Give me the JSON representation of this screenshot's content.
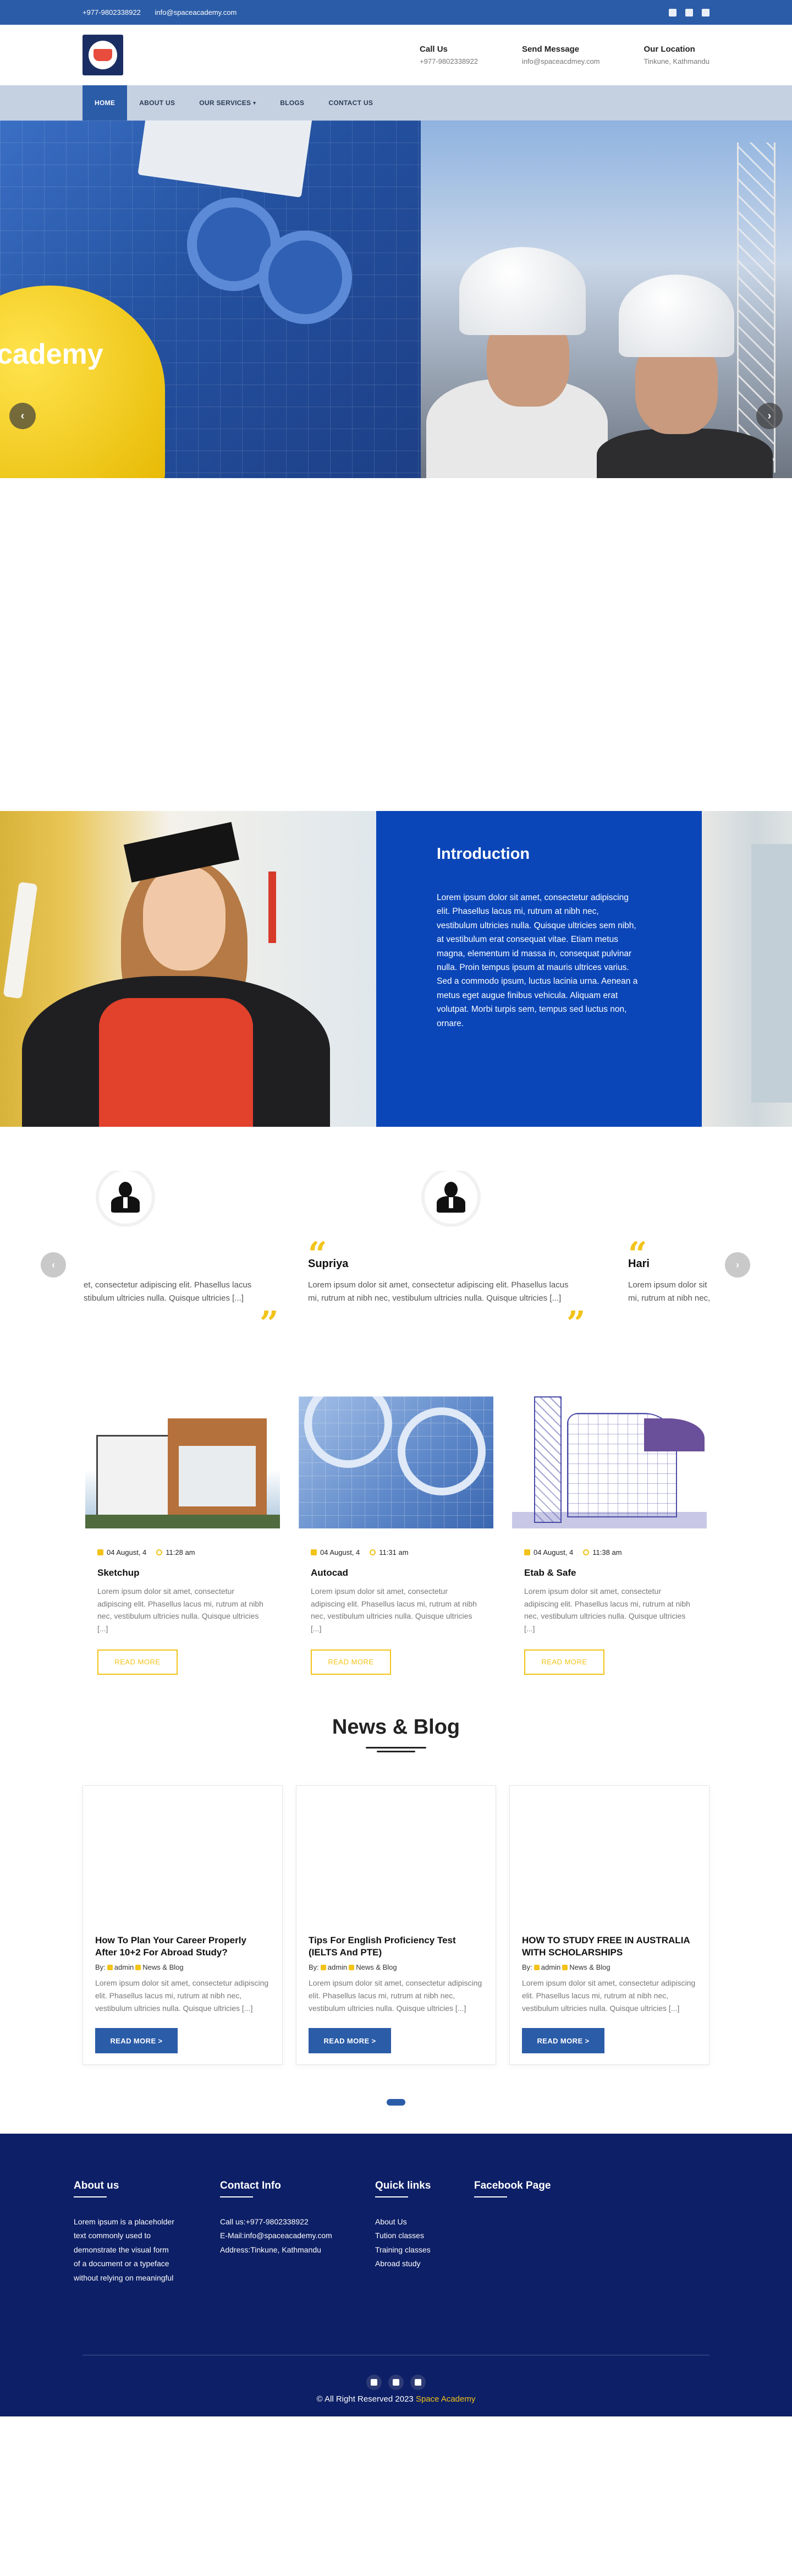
{
  "topbar": {
    "phone": "+977-9802338922",
    "email": "info@spaceacademy.com",
    "socials": [
      "facebook-icon",
      "youtube-icon",
      "instagram-icon"
    ]
  },
  "header": {
    "call": {
      "title": "Call Us",
      "value": "+977-9802338922"
    },
    "message": {
      "title": "Send Message",
      "value": "info@spaceacdmey.com"
    },
    "location": {
      "title": "Our Location",
      "value": "Tinkune, Kathmandu"
    }
  },
  "nav": {
    "items": [
      "HOME",
      "ABOUT US",
      "OUR SERVICES",
      "BLOGS",
      "CONTACT US"
    ],
    "active": "HOME"
  },
  "hero": {
    "title": "cademy",
    "prev": "‹",
    "next": "›"
  },
  "intro": {
    "title": "Introduction",
    "text": "Lorem ipsum dolor sit amet, consectetur adipiscing elit. Phasellus lacus mi, rutrum at nibh nec, vestibulum ultricies nulla. Quisque ultricies sem nibh, at vestibulum erat consequat vitae. Etiam metus magna, elementum id massa in, consequat pulvinar nulla. Proin tempus ipsum at mauris ultrices varius. Sed a commodo ipsum, luctus lacinia urna. Aenean a metus eget augue finibus vehicula. Aliquam erat volutpat. Morbi turpis sem, tempus sed luctus non, ornare."
  },
  "testimonials": {
    "prev": "‹",
    "next": "›",
    "items": [
      {
        "name": "",
        "line1": "et, consectetur adipiscing elit. Phasellus lacus",
        "line2": "stibulum ultricies nulla. Quisque ultricies [...]"
      },
      {
        "name": "Supriya",
        "line1": "Lorem ipsum dolor sit amet, consectetur adipiscing elit. Phasellus lacus",
        "line2": "mi, rutrum at nibh nec, vestibulum ultricies nulla. Quisque ultricies [...]"
      },
      {
        "name": "Hari",
        "line1": "Lorem ipsum dolor sit amet, c",
        "line2": "mi, rutrum at nibh nec, vestib"
      }
    ]
  },
  "courses": [
    {
      "date": "04 August, 4",
      "time": "11:28 am",
      "title": "Sketchup",
      "text": "Lorem ipsum dolor sit amet, consectetur adipiscing elit. Phasellus lacus mi, rutrum at nibh nec, vestibulum ultricies nulla. Quisque ultricies [...]",
      "button": "READ MORE"
    },
    {
      "date": "04 August, 4",
      "time": "11:31 am",
      "title": "Autocad",
      "text": "Lorem ipsum dolor sit amet, consectetur adipiscing elit. Phasellus lacus mi, rutrum at nibh nec, vestibulum ultricies nulla. Quisque ultricies [...]",
      "button": "READ MORE"
    },
    {
      "date": "04 August, 4",
      "time": "11:38 am",
      "title": "Etab & Safe",
      "text": "Lorem ipsum dolor sit amet, consectetur adipiscing elit. Phasellus lacus mi, rutrum at nibh nec, vestibulum ultricies nulla. Quisque ultricies [...]",
      "button": "READ MORE"
    }
  ],
  "news": {
    "title": "News & Blog",
    "posts": [
      {
        "title": "How To Plan Your Career Properly After 10+2 For Abroad Study?",
        "by": "By:",
        "author": "admin",
        "category": "News & Blog",
        "text": "Lorem ipsum dolor sit amet, consectetur adipiscing elit. Phasellus lacus mi, rutrum at nibh nec, vestibulum ultricies nulla. Quisque ultricies [...]",
        "button": "READ MORE >"
      },
      {
        "title": "Tips For English Proficiency Test (IELTS And PTE)",
        "by": "By:",
        "author": "admin",
        "category": "News & Blog",
        "text": "Lorem ipsum dolor sit amet, consectetur adipiscing elit. Phasellus lacus mi, rutrum at nibh nec, vestibulum ultricies nulla. Quisque ultricies [...]",
        "button": "READ MORE >"
      },
      {
        "title": "HOW TO STUDY FREE IN AUSTRALIA WITH SCHOLARSHIPS",
        "by": "By:",
        "author": "admin",
        "category": "News & Blog",
        "text": "Lorem ipsum dolor sit amet, consectetur adipiscing elit. Phasellus lacus mi, rutrum at nibh nec, vestibulum ultricies nulla. Quisque ultricies [...]",
        "button": "READ MORE >"
      }
    ]
  },
  "footer": {
    "about": {
      "title": "About us",
      "lines": [
        "Lorem ipsum is a placeholder",
        "text commonly used to",
        "demonstrate the visual form",
        "of a document or a typeface",
        "without relying on meaningful"
      ]
    },
    "contact": {
      "title": "Contact Info",
      "lines": [
        "Call us:+977-9802338922",
        "E-Mail:info@spaceacademy.com",
        "Address:Tinkune, Kathmandu"
      ]
    },
    "links": {
      "title": "Quick links",
      "items": [
        "About Us",
        "Tution classes",
        "Training classes",
        "Abroad study"
      ]
    },
    "facebook": {
      "title": "Facebook Page"
    },
    "socials": [
      "facebook-icon",
      "youtube-icon",
      "instagram-icon"
    ],
    "copyright": "© All Right Reserved 2023",
    "brand": "Space Academy"
  }
}
